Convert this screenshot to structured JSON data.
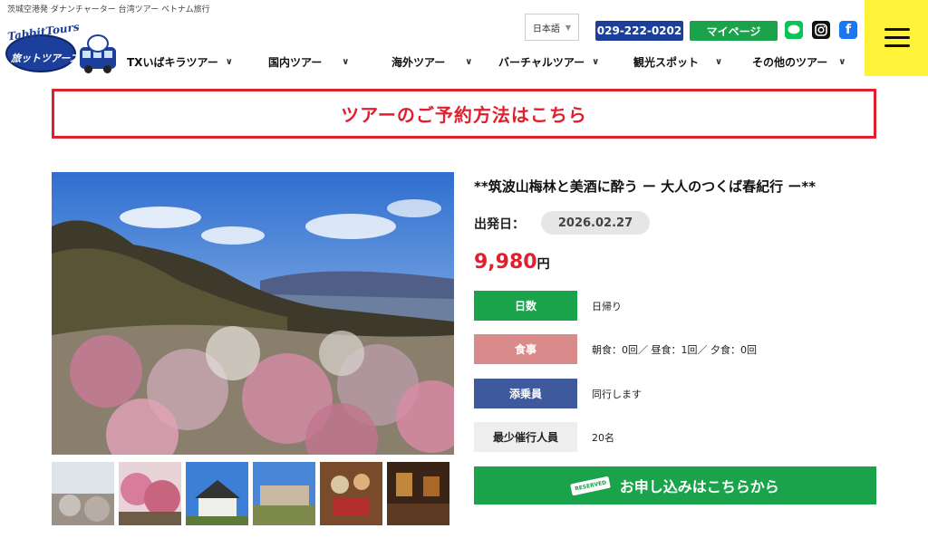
{
  "header": {
    "tagline": "茨城空港発 ダナンチャーター 台湾ツアー ベトナム旅行",
    "logo_top": "TabbitTours",
    "logo_bottom": "旅ットツアーズ",
    "language": "日本語",
    "language_caret": "▼",
    "phone": "029-222-0202",
    "mypage": "マイページ",
    "sns": {
      "line": "LINE",
      "instagram": "IG",
      "facebook": "f"
    }
  },
  "nav": [
    {
      "label": "TXいばキラツアー"
    },
    {
      "label": "国内ツアー"
    },
    {
      "label": "海外ツアー"
    },
    {
      "label": "バーチャルツアー"
    },
    {
      "label": "観光スポット"
    },
    {
      "label": "その他のツアー"
    }
  ],
  "reserve_banner": "ツアーのご予約方法はこちら",
  "tour": {
    "title": "**筑波山梅林と美酒に酔う ー 大人のつくば春紀行 ー**",
    "departure_label": "出発日：",
    "departure_date": "2026.02.27",
    "price": "9,980",
    "price_unit": "円",
    "info": [
      {
        "label": "日数",
        "value": "日帰り",
        "color": "#1aa34a"
      },
      {
        "label": "食事",
        "value": "朝食：0回／ 昼食：1回／ 夕食：0回",
        "color": "#d98a8a"
      },
      {
        "label": "添乗員",
        "value": "同行します",
        "color": "#3e5a9c"
      },
      {
        "label": "最少催行人員",
        "value": "20名",
        "color": "#eeeeee"
      }
    ],
    "apply_tag": "RESERVED",
    "apply_label": "お申し込みはこちらから"
  },
  "thumbnails": [
    {
      "name": "thumb-misty-plum-hill"
    },
    {
      "name": "thumb-plum-blossoms"
    },
    {
      "name": "thumb-country-house"
    },
    {
      "name": "thumb-building"
    },
    {
      "name": "thumb-lunch-set"
    },
    {
      "name": "thumb-interior"
    }
  ]
}
